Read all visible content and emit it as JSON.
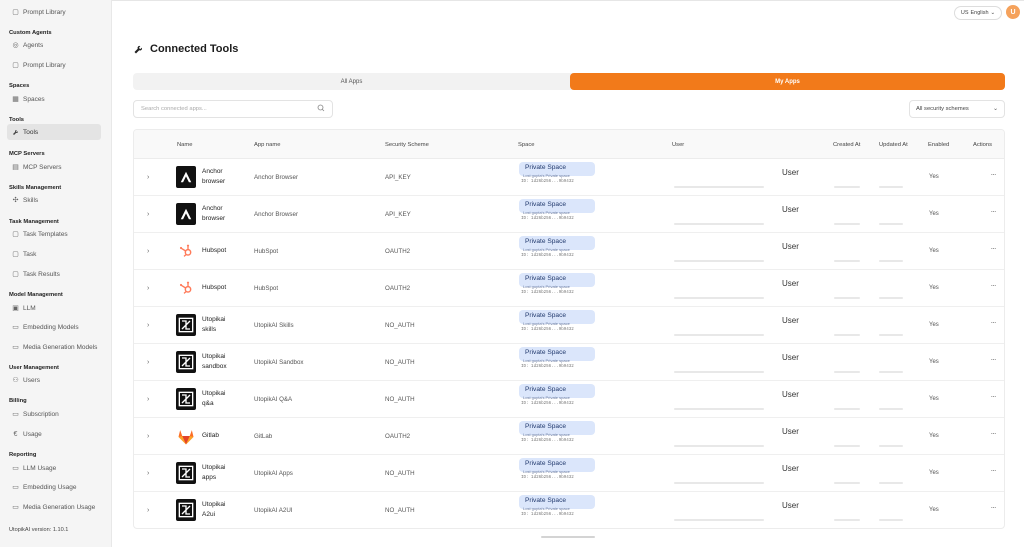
{
  "sidebar": {
    "top_item": "Prompt Library",
    "sections": [
      {
        "heading": "Custom Agents",
        "items": [
          {
            "label": "Agents",
            "icon": "agent-icon"
          },
          {
            "label": "Prompt Library",
            "icon": "library-icon"
          }
        ]
      },
      {
        "heading": "Spaces",
        "items": [
          {
            "label": "Spaces",
            "icon": "spaces-icon"
          }
        ]
      },
      {
        "heading": "Tools",
        "items": [
          {
            "label": "Tools",
            "icon": "wrench-icon",
            "active": true
          }
        ]
      },
      {
        "heading": "MCP Servers",
        "items": [
          {
            "label": "MCP Servers",
            "icon": "server-icon"
          }
        ]
      },
      {
        "heading": "Skills Management",
        "items": [
          {
            "label": "Skills",
            "icon": "skills-icon"
          }
        ]
      },
      {
        "heading": "Task Management",
        "items": [
          {
            "label": "Task Templates",
            "icon": "template-icon"
          },
          {
            "label": "Task",
            "icon": "task-icon"
          },
          {
            "label": "Task Results",
            "icon": "results-icon"
          }
        ]
      },
      {
        "heading": "Model Management",
        "items": [
          {
            "label": "LLM",
            "icon": "llm-icon"
          },
          {
            "label": "Embedding Models",
            "icon": "embedding-icon"
          },
          {
            "label": "Media Generation Models",
            "icon": "media-icon"
          }
        ]
      },
      {
        "heading": "User Management",
        "items": [
          {
            "label": "Users",
            "icon": "users-icon"
          }
        ]
      },
      {
        "heading": "Billing",
        "items": [
          {
            "label": "Subscription",
            "icon": "subscription-icon"
          },
          {
            "label": "Usage",
            "icon": "euro-icon"
          }
        ]
      },
      {
        "heading": "Reporting",
        "items": [
          {
            "label": "LLM Usage",
            "icon": "report-icon"
          },
          {
            "label": "Embedding Usage",
            "icon": "report-icon"
          },
          {
            "label": "Media Generation Usage",
            "icon": "report-icon"
          }
        ]
      }
    ],
    "version": "UtopikAI version: 1.10.1"
  },
  "header": {
    "lang_flag": "US",
    "lang_label": "English",
    "avatar_initial": "U"
  },
  "page": {
    "title": "Connected Tools",
    "tabs": [
      {
        "label": "All Apps",
        "active": false
      },
      {
        "label": "My Apps",
        "active": true
      }
    ],
    "search_placeholder": "Search connected apps...",
    "filter_label": "All security schemes"
  },
  "table": {
    "columns": {
      "name": "Name",
      "app_name": "App name",
      "security": "Security Scheme",
      "space": "Space",
      "user": "User",
      "created": "Created At",
      "updated": "Updated At",
      "enabled": "Enabled",
      "actions": "Actions"
    },
    "rows": [
      {
        "name": "Anchor browser",
        "logo": "anchor",
        "app": "Anchor Browser",
        "scheme": "API_KEY",
        "space": "Private Space",
        "space_sub": "Lost gupta's Private space",
        "space_id": "ID: 1d26b256...9b9432",
        "user": "User",
        "enabled": "Yes"
      },
      {
        "name": "Anchor browser",
        "logo": "anchor",
        "app": "Anchor Browser",
        "scheme": "API_KEY",
        "space": "Private Space",
        "space_sub": "Lost gupta's Private space",
        "space_id": "ID: 1d26b256...9b9432",
        "user": "User",
        "enabled": "Yes"
      },
      {
        "name": "Hubspot",
        "logo": "hubspot",
        "app": "HubSpot",
        "scheme": "OAUTH2",
        "space": "Private Space",
        "space_sub": "Lost gupta's Private space",
        "space_id": "ID: 1d26b256...9b9432",
        "user": "User",
        "enabled": "Yes"
      },
      {
        "name": "Hubspot",
        "logo": "hubspot",
        "app": "HubSpot",
        "scheme": "OAUTH2",
        "space": "Private Space",
        "space_sub": "Lost gupta's Private space",
        "space_id": "ID: 1d26b256...9b9432",
        "user": "User",
        "enabled": "Yes"
      },
      {
        "name": "Utopikai skills",
        "logo": "utopik",
        "app": "UtopikAI Skills",
        "scheme": "NO_AUTH",
        "space": "Private Space",
        "space_sub": "Lost gupta's Private space",
        "space_id": "ID: 1d26b256...9b9432",
        "user": "User",
        "enabled": "Yes"
      },
      {
        "name": "Utopikai sandbox",
        "logo": "utopik",
        "app": "UtopikAI Sandbox",
        "scheme": "NO_AUTH",
        "space": "Private Space",
        "space_sub": "Lost gupta's Private space",
        "space_id": "ID: 1d26b256...9b9432",
        "user": "User",
        "enabled": "Yes"
      },
      {
        "name": "Utopikai q&a",
        "logo": "utopik",
        "app": "UtopikAI Q&A",
        "scheme": "NO_AUTH",
        "space": "Private Space",
        "space_sub": "Lost gupta's Private space",
        "space_id": "ID: 1d26b256...9b9432",
        "user": "User",
        "enabled": "Yes"
      },
      {
        "name": "Gitlab",
        "logo": "gitlab",
        "app": "GitLab",
        "scheme": "OAUTH2",
        "space": "Private Space",
        "space_sub": "Lost gupta's Private space",
        "space_id": "ID: 1d26b256...9b9432",
        "user": "User",
        "enabled": "Yes"
      },
      {
        "name": "Utopikai apps",
        "logo": "utopik",
        "app": "UtopikAI Apps",
        "scheme": "NO_AUTH",
        "space": "Private Space",
        "space_sub": "Lost gupta's Private space",
        "space_id": "ID: 1d26b256...9b9432",
        "user": "User",
        "enabled": "Yes"
      },
      {
        "name": "Utopikai A2ui",
        "logo": "utopik",
        "app": "UtopikAI A2UI",
        "scheme": "NO_AUTH",
        "space": "Private Space",
        "space_sub": "Lost gupta's Private space",
        "space_id": "ID: 1d26b256...9b9432",
        "user": "User",
        "enabled": "Yes"
      }
    ]
  },
  "colors": {
    "accent": "#f27a1a",
    "space_badge": "#dbe6fb",
    "hubspot": "#ff7a59",
    "gitlab": "#fc6d26"
  }
}
